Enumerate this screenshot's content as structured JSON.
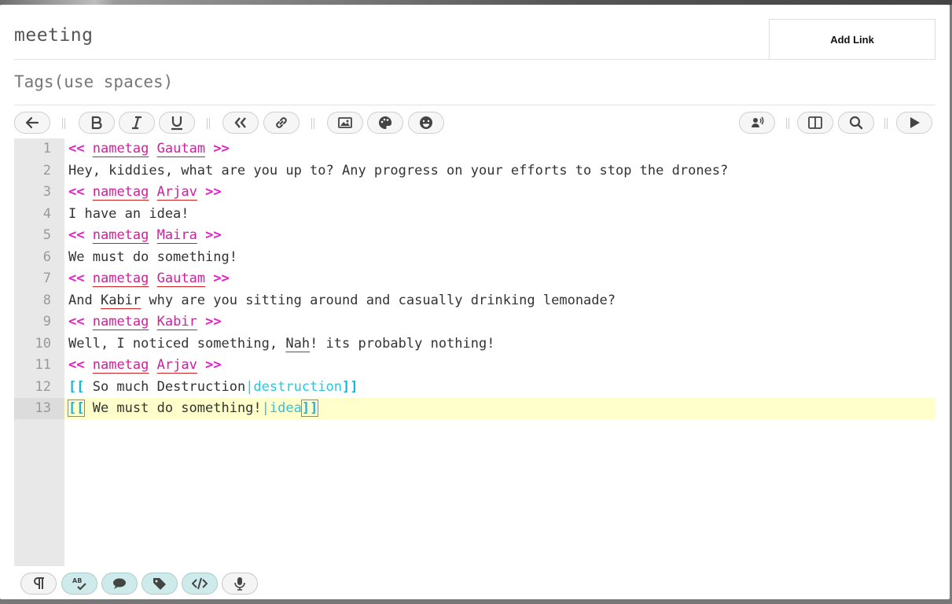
{
  "dialog": {
    "title": "meeting",
    "tags_placeholder": "Tags(use spaces)",
    "add_link_label": "Add Link"
  },
  "toolbar": {
    "left": [
      "back-icon",
      "bold-icon",
      "italic-icon",
      "underline-icon",
      "quote-icon",
      "link-icon",
      "image-icon",
      "palette-icon",
      "emoji-icon"
    ],
    "right": [
      "speaker-icon",
      "split-view-icon",
      "search-icon",
      "play-icon"
    ]
  },
  "editor": {
    "active_line": 13,
    "lines": [
      {
        "n": "1",
        "a": "<<",
        "b": "nametag",
        "c": "Gautam",
        "d": ">>"
      },
      {
        "n": "2",
        "t": "Hey, kiddies, what are you up to? Any progress on your efforts to stop the drones?"
      },
      {
        "n": "3",
        "a": "<<",
        "b": "nametag",
        "c": "Arjav",
        "d": ">>"
      },
      {
        "n": "4",
        "t": "I have an idea!"
      },
      {
        "n": "5",
        "a": "<<",
        "b": "nametag",
        "c": "Maira",
        "d": ">>"
      },
      {
        "n": "6",
        "t": "We must do something!"
      },
      {
        "n": "7",
        "a": "<<",
        "b": "nametag",
        "c": "Gautam",
        "d": ">>"
      },
      {
        "n": "8",
        "t1": "And ",
        "t2": "Kabir",
        "t3": " why are you sitting around and casually drinking lemonade?"
      },
      {
        "n": "9",
        "a": "<<",
        "b": "nametag",
        "c": "Kabir",
        "d": ">>"
      },
      {
        "n": "10",
        "t1": "Well, I noticed something, ",
        "t2": "Nah",
        "t3": "! its probably nothing!"
      },
      {
        "n": "11",
        "a": "<<",
        "b": "nametag",
        "c": "Arjav",
        "d": ">>"
      },
      {
        "n": "12",
        "o": "[[",
        "t": " So much Destruction",
        "p": "|destruction",
        "cl": "]]"
      },
      {
        "n": "13",
        "o": "[[",
        "t": " We must do something!",
        "p": "|idea",
        "cl": "]]"
      }
    ]
  },
  "statusbar": [
    "paragraph-icon",
    "spellcheck-icon",
    "comment-icon",
    "tag-icon",
    "code-icon",
    "microphone-icon"
  ]
}
